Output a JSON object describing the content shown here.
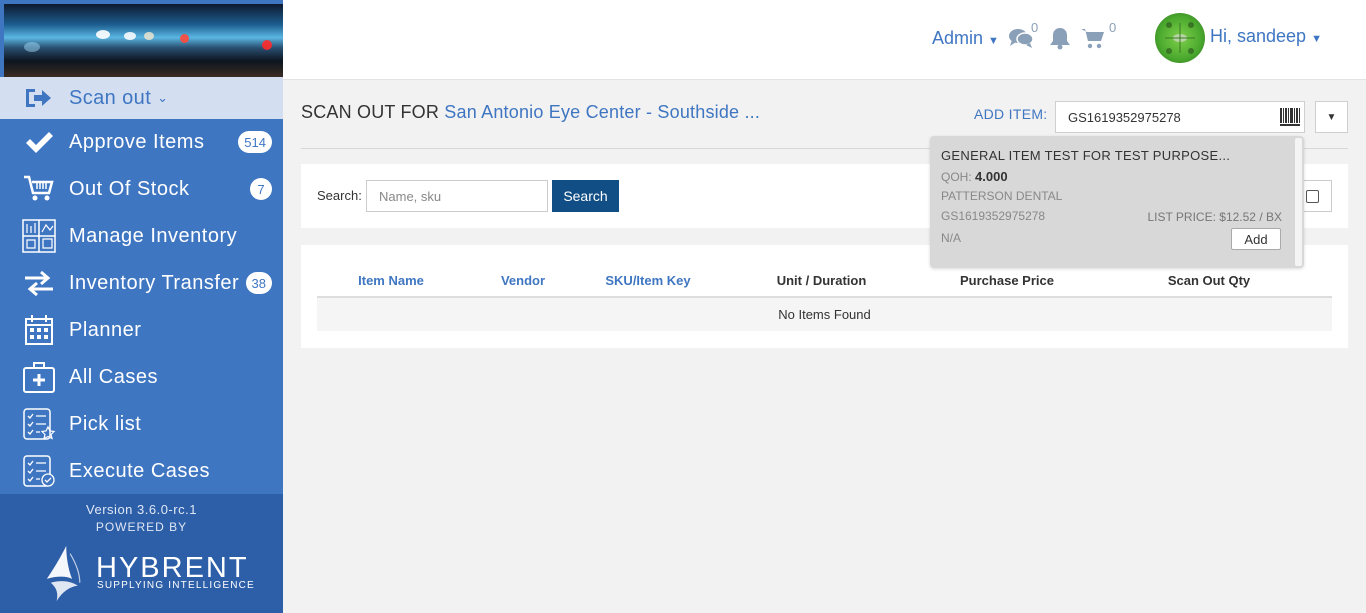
{
  "sidebar": {
    "active_item": {
      "label": "Scan out",
      "icon": "sign-out-icon"
    },
    "items": [
      {
        "label": "Approve Items",
        "icon": "checkmark-icon",
        "badge": "514"
      },
      {
        "label": "Out Of Stock",
        "icon": "cart-icon",
        "badge": "7"
      },
      {
        "label": "Manage Inventory",
        "icon": "inventory-grid-icon",
        "badge": null
      },
      {
        "label": "Inventory Transfer",
        "icon": "transfer-arrows-icon",
        "badge": "38"
      },
      {
        "label": "Planner",
        "icon": "calendar-icon",
        "badge": null
      },
      {
        "label": "All Cases",
        "icon": "medical-kit-icon",
        "badge": null
      },
      {
        "label": "Pick list",
        "icon": "checklist-star-icon",
        "badge": null
      },
      {
        "label": "Execute Cases",
        "icon": "checklist-check-icon",
        "badge": null
      }
    ],
    "version": "Version 3.6.0-rc.1",
    "powered_by": "POWERED BY",
    "brand_name": "HYBRENT",
    "brand_tagline": "SUPPLYING INTELLIGENCE"
  },
  "header": {
    "admin_label": "Admin",
    "messages_count": "0",
    "cart_count": "0",
    "user_greeting": "Hi, sandeep"
  },
  "main": {
    "heading_prefix": "SCAN OUT FOR",
    "heading_location": "San Antonio Eye Center - Southside ...",
    "add_item_label": "ADD ITEM:",
    "add_item_value": "GS1619352975278",
    "search_label": "Search:",
    "search_placeholder": "Name, sku",
    "search_button": "Search",
    "table": {
      "columns": [
        "Item Name",
        "Vendor",
        "SKU/Item Key",
        "Unit / Duration",
        "Purchase Price",
        "Scan Out Qty"
      ],
      "empty_text": "No Items Found"
    }
  },
  "suggestion": {
    "name": "GENERAL ITEM TEST FOR TEST PURPOSE...",
    "qoh_label": "QOH:",
    "qoh_value": "4.000",
    "vendor": "PATTERSON DENTAL",
    "sku": "GS1619352975278",
    "price_label": "LIST PRICE:",
    "price_value": "$12.52 / BX",
    "extra": "N/A",
    "add_button": "Add"
  },
  "colors": {
    "sidebar": "#3f76c2",
    "sidebar_active": "#d3dff0",
    "accent": "#3f76c2",
    "search_button": "#124e86"
  }
}
